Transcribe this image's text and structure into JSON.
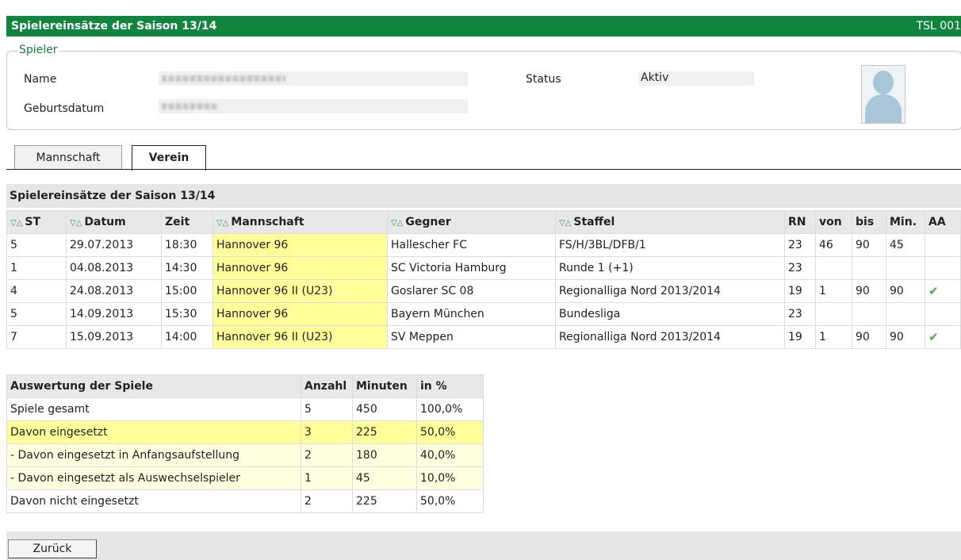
{
  "header": {
    "title": "Spielereinsätze der Saison 13/14",
    "code": "TSL 001"
  },
  "player": {
    "legend": "Spieler",
    "name_label": "Name",
    "birth_label": "Geburtsdatum",
    "status_label": "Status",
    "status_value": "Aktiv"
  },
  "tabs": [
    {
      "label": "Mannschaft",
      "active": false
    },
    {
      "label": "Verein",
      "active": true
    }
  ],
  "games": {
    "section_title": "Spielereinsätze der Saison 13/14",
    "columns": [
      "ST",
      "Datum",
      "Zeit",
      "Mannschaft",
      "Gegner",
      "Staffel",
      "RN",
      "von",
      "bis",
      "Min.",
      "AA"
    ],
    "rows": [
      {
        "st": "5",
        "datum": "29.07.2013",
        "zeit": "18:30",
        "mannschaft": "Hannover 96",
        "gegner": "Hallescher FC",
        "staffel": "FS/H/3BL/DFB/1",
        "rn": "23",
        "von": "46",
        "bis": "90",
        "min": "45",
        "aa": false
      },
      {
        "st": "1",
        "datum": "04.08.2013",
        "zeit": "14:30",
        "mannschaft": "Hannover 96",
        "gegner": "SC Victoria Hamburg",
        "staffel": "Runde 1 (+1)",
        "rn": "23",
        "von": "",
        "bis": "",
        "min": "",
        "aa": false
      },
      {
        "st": "4",
        "datum": "24.08.2013",
        "zeit": "15:00",
        "mannschaft": "Hannover 96 II (U23)",
        "gegner": "Goslarer SC 08",
        "staffel": "Regionalliga Nord 2013/2014",
        "rn": "19",
        "von": "1",
        "bis": "90",
        "min": "90",
        "aa": true
      },
      {
        "st": "5",
        "datum": "14.09.2013",
        "zeit": "15:30",
        "mannschaft": "Hannover 96",
        "gegner": "Bayern München",
        "staffel": "Bundesliga",
        "rn": "23",
        "von": "",
        "bis": "",
        "min": "",
        "aa": false
      },
      {
        "st": "7",
        "datum": "15.09.2013",
        "zeit": "14:00",
        "mannschaft": "Hannover 96 II (U23)",
        "gegner": "SV Meppen",
        "staffel": "Regionalliga Nord 2013/2014",
        "rn": "19",
        "von": "1",
        "bis": "90",
        "min": "90",
        "aa": true
      }
    ]
  },
  "summary": {
    "columns": [
      "Auswertung der Spiele",
      "Anzahl",
      "Minuten",
      "in %"
    ],
    "rows": [
      {
        "label": "Spiele gesamt",
        "anzahl": "5",
        "minuten": "450",
        "pct": "100,0%",
        "style": "normal"
      },
      {
        "label": "Davon eingesetzt",
        "anzahl": "3",
        "minuten": "225",
        "pct": "50,0%",
        "style": "highlight"
      },
      {
        "label": "- Davon eingesetzt in Anfangsaufstellung",
        "anzahl": "2",
        "minuten": "180",
        "pct": "40,0%",
        "style": "light"
      },
      {
        "label": "- Davon eingesetzt als Auswechselspieler",
        "anzahl": "1",
        "minuten": "45",
        "pct": "10,0%",
        "style": "light"
      },
      {
        "label": "Davon nicht eingesetzt",
        "anzahl": "2",
        "minuten": "225",
        "pct": "50,0%",
        "style": "normal"
      }
    ]
  },
  "footer": {
    "back_label": "Zurück"
  },
  "icons": {
    "sort": "sort-arrows-icon",
    "check": "checkmark-icon",
    "avatar": "person-placeholder-icon"
  },
  "colors": {
    "header_green": "#11853d",
    "highlight_yellow": "#ffff99"
  }
}
